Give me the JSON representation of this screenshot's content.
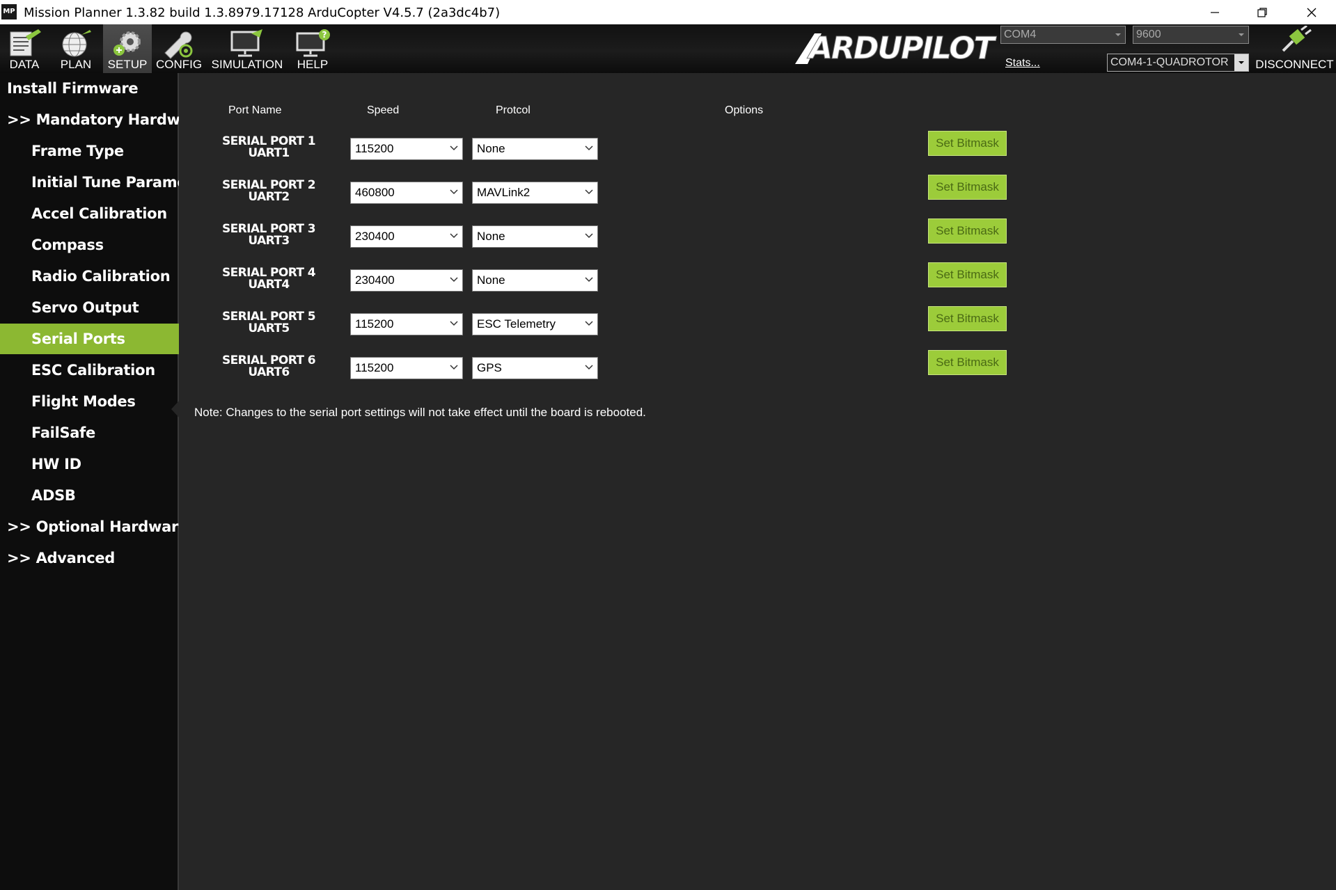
{
  "window": {
    "icon_text": "MP",
    "title": "Mission Planner 1.3.82 build 1.3.8979.17128 ArduCopter V4.5.7 (2a3dc4b7)"
  },
  "toolbar": {
    "items": [
      {
        "label": "DATA",
        "icon": "data-icon"
      },
      {
        "label": "PLAN",
        "icon": "globe-icon"
      },
      {
        "label": "SETUP",
        "icon": "gears-icon"
      },
      {
        "label": "CONFIG",
        "icon": "wrench-icon"
      },
      {
        "label": "SIMULATION",
        "icon": "monitor-plane-icon"
      },
      {
        "label": "HELP",
        "icon": "monitor-help-icon"
      }
    ],
    "active": "SETUP",
    "logo_text": "ARDUPILOT",
    "com_port": "COM4",
    "baud_rate": "9600",
    "stats_link": "Stats...",
    "connection_profile": "COM4-1-QUADROTOR",
    "disconnect_label": "DISCONNECT"
  },
  "sidebar": {
    "items": [
      {
        "label": "Install Firmware",
        "level": 1
      },
      {
        "label": ">> Mandatory Hardware",
        "level": 1
      },
      {
        "label": "Frame Type",
        "level": 2
      },
      {
        "label": "Initial Tune Paramete",
        "level": 2
      },
      {
        "label": "Accel Calibration",
        "level": 2
      },
      {
        "label": "Compass",
        "level": 2
      },
      {
        "label": "Radio Calibration",
        "level": 2
      },
      {
        "label": "Servo Output",
        "level": 2
      },
      {
        "label": "Serial Ports",
        "level": 2,
        "active": true
      },
      {
        "label": "ESC Calibration",
        "level": 2
      },
      {
        "label": "Flight Modes",
        "level": 2
      },
      {
        "label": "FailSafe",
        "level": 2
      },
      {
        "label": "HW ID",
        "level": 2
      },
      {
        "label": "ADSB",
        "level": 2
      },
      {
        "label": ">> Optional Hardware",
        "level": 1
      },
      {
        "label": ">> Advanced",
        "level": 1
      }
    ]
  },
  "serial_ports": {
    "headers": {
      "port_name": "Port Name",
      "speed": "Speed",
      "protocol": "Protcol",
      "options": "Options"
    },
    "rows": [
      {
        "name": "SERIAL PORT 1",
        "uart": "UART1",
        "speed": "115200",
        "protocol": "None",
        "button": "Set Bitmask"
      },
      {
        "name": "SERIAL PORT 2",
        "uart": "UART2",
        "speed": "460800",
        "protocol": "MAVLink2",
        "button": "Set Bitmask"
      },
      {
        "name": "SERIAL PORT 3",
        "uart": "UART3",
        "speed": "230400",
        "protocol": "None",
        "button": "Set Bitmask"
      },
      {
        "name": "SERIAL PORT 4",
        "uart": "UART4",
        "speed": "230400",
        "protocol": "None",
        "button": "Set Bitmask"
      },
      {
        "name": "SERIAL PORT 5",
        "uart": "UART5",
        "speed": "115200",
        "protocol": "ESC Telemetry",
        "button": "Set Bitmask"
      },
      {
        "name": "SERIAL PORT 6",
        "uart": "UART6",
        "speed": "115200",
        "protocol": "GPS",
        "button": "Set Bitmask"
      }
    ],
    "note": "Note: Changes to the serial port settings will not take effect until the board is rebooted."
  },
  "colors": {
    "accent_green": "#8cb832",
    "button_green": "#9ccc3a",
    "background": "#262626",
    "sidebar": "#0d0d0d"
  }
}
